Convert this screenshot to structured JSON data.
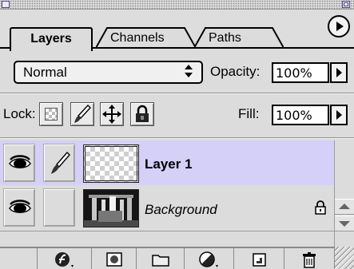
{
  "tabs": [
    {
      "label": "Layers",
      "active": true
    },
    {
      "label": "Channels",
      "active": false
    },
    {
      "label": "Paths",
      "active": false
    }
  ],
  "blend_mode": {
    "value": "Normal",
    "arrows": "↕"
  },
  "opacity": {
    "label": "Opacity:",
    "value": "100%"
  },
  "lock": {
    "label": "Lock:"
  },
  "fill": {
    "label": "Fill:",
    "value": "100%"
  },
  "layers": [
    {
      "name": "Layer 1",
      "visible": true,
      "active": true,
      "thumbnail": "transparent"
    },
    {
      "name": "Background",
      "visible": true,
      "active": false,
      "locked": true,
      "thumbnail": "photo"
    }
  ],
  "colors": {
    "panel_bg": "#dcdcdc",
    "selected_row": "#d4d0f8",
    "tab_border": "#000000"
  },
  "icons": {
    "eye": "eye-icon",
    "brush": "brush-icon",
    "lock": "padlock-icon",
    "move": "move-cross-icon",
    "styles": "layer-style-icon",
    "mask": "mask-icon",
    "folder": "folder-icon",
    "adjustment": "adjustment-circle-icon",
    "new_layer": "new-layer-icon",
    "trash": "trash-icon"
  }
}
